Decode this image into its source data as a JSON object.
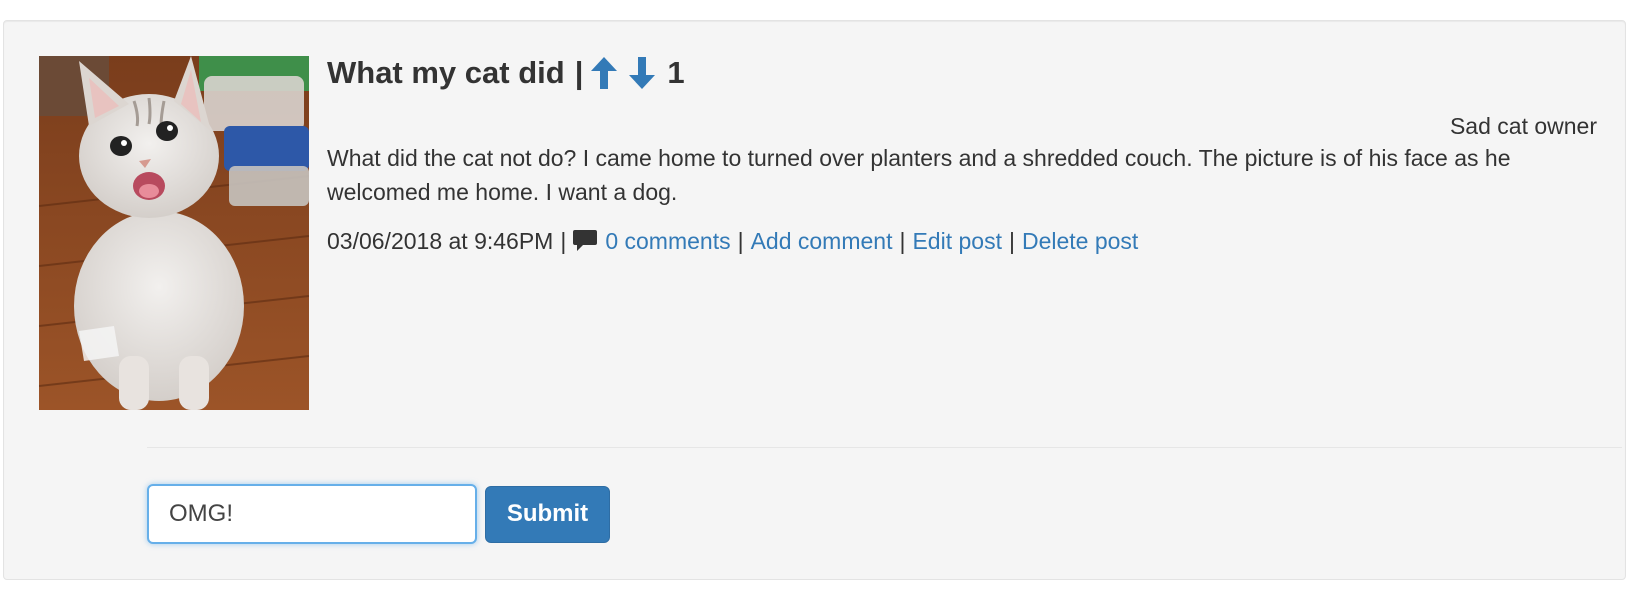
{
  "post": {
    "title": "What my cat did",
    "title_separator": "|",
    "score": "1",
    "author": "Sad cat owner",
    "content": "What did the cat not do? I came home to turned over planters and a shredded couch. The picture is of his face as he welcomed me home. I want a dog.",
    "timestamp": "03/06/2018 at 9:46PM",
    "meta_separator": "|",
    "comments_link": "0 comments",
    "add_comment_link": "Add comment",
    "edit_link": "Edit post",
    "delete_link": "Delete post",
    "image_alt": "photo of a smiling white cat sitting on a wooden floor"
  },
  "comment_form": {
    "input_value": "OMG!",
    "submit_label": "Submit"
  },
  "icons": {
    "upvote": "arrow-up-icon",
    "downvote": "arrow-down-icon",
    "comment": "comment-icon"
  },
  "colors": {
    "link": "#337ab7",
    "card_background": "#f5f5f5",
    "text": "#333333",
    "focus_border": "#66afe9"
  }
}
